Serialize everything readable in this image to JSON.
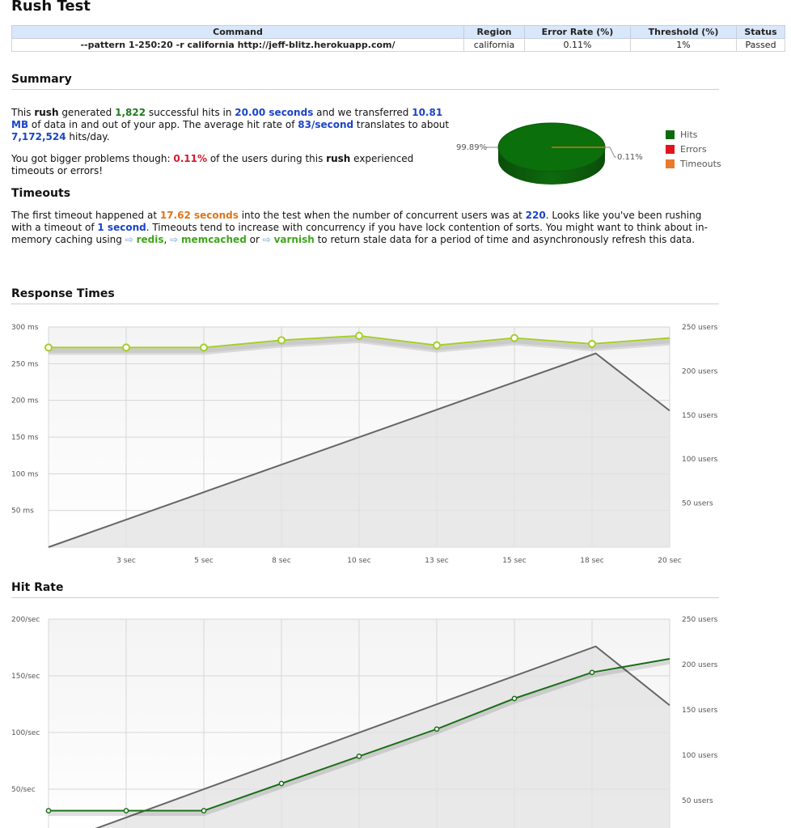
{
  "title": "Rush Test",
  "table": {
    "headers": [
      "Command",
      "Region",
      "Error Rate (%)",
      "Threshold (%)",
      "Status"
    ],
    "row": [
      "--pattern 1-250:20 -r california http://jeff-blitz.herokuapp.com/",
      "california",
      "0.11%",
      "1%",
      "Passed"
    ]
  },
  "summary": {
    "heading": "Summary",
    "p1": {
      "t1": "This ",
      "rush": "rush",
      "t2": " generated ",
      "hits": "1,822",
      "t3": " successful hits in ",
      "secs": "20.00 seconds",
      "t4": " and we transferred ",
      "mb": "10.81 MB",
      "t5": " of data in and out of your app. The average hit rate of ",
      "rate": "83/second",
      "t6": " translates to about ",
      "perday": "7,172,524",
      "t7": " hits/day."
    },
    "p2": {
      "t1": "You got bigger problems though: ",
      "pct": "0.11%",
      "t2": " of the users during this ",
      "rush": "rush",
      "t3": " experienced timeouts or errors!"
    }
  },
  "pie": {
    "hits_pct": 99.89,
    "errors_pct": 0.0,
    "timeouts_pct": 0.11,
    "label_hits": "99.89%",
    "label_timeouts": "0.11%",
    "legend": [
      {
        "label": "Hits",
        "color": "#0b6b0b"
      },
      {
        "label": "Errors",
        "color": "#e0141e"
      },
      {
        "label": "Timeouts",
        "color": "#e87a2e"
      }
    ]
  },
  "timeouts": {
    "heading": "Timeouts",
    "t1": "The first timeout happened at ",
    "at": "17.62 seconds",
    "t2": " into the test when the number of concurrent users was at ",
    "users": "220",
    "t3": ". Looks like you've been rushing with a timeout of ",
    "timeout": "1 second",
    "t4": ". Timeouts tend to increase with concurrency if you have lock contention of sorts. You might want to think about in-memory caching using ",
    "redis": "redis",
    "sep1": ", ",
    "memcached": "memcached",
    "sep2": " or ",
    "varnish": "varnish",
    "t5": " to return stale data for a period of time and asynchronously refresh this data.",
    "arrow": "⇨"
  },
  "colors": {
    "hits_line": "#1a6e17",
    "response_line": "#a4cf28",
    "users_line": "#666666"
  },
  "chart_data": [
    {
      "type": "line",
      "title": "Response Times",
      "x": [
        0,
        2.5,
        5,
        7.5,
        10,
        12.5,
        15,
        17.5,
        20
      ],
      "x_tick_labels": [
        "3 sec",
        "5 sec",
        "8 sec",
        "10 sec",
        "13 sec",
        "15 sec",
        "18 sec",
        "20 sec"
      ],
      "y_left_ticks": [
        "300 ms",
        "250 ms",
        "200 ms",
        "150 ms",
        "100 ms",
        "50 ms"
      ],
      "y_right_ticks": [
        "250 users",
        "200 users",
        "150 users",
        "100 users",
        "50 users"
      ],
      "ylim_left": [
        0,
        300
      ],
      "ylim_right": [
        0,
        250
      ],
      "series": [
        {
          "axis": "left",
          "values": [
            272,
            272,
            272,
            282,
            288,
            275,
            285,
            277,
            285
          ],
          "markers": [
            true,
            true,
            true,
            true,
            true,
            true,
            true,
            true,
            false
          ]
        },
        {
          "axis": "right",
          "x": [
            0,
            17.62,
            20
          ],
          "values": [
            0,
            220,
            155
          ]
        }
      ]
    },
    {
      "type": "line",
      "title": "Hit Rate",
      "x": [
        0,
        2.5,
        5,
        7.5,
        10,
        12.5,
        15,
        17.5,
        20
      ],
      "y_left_ticks": [
        "200/sec",
        "150/sec",
        "100/sec",
        "50/sec"
      ],
      "y_right_ticks": [
        "250 users",
        "200 users",
        "150 users",
        "100 users",
        "50 users"
      ],
      "ylim_left": [
        0,
        200
      ],
      "ylim_right": [
        0,
        250
      ],
      "series": [
        {
          "axis": "left",
          "values": [
            31,
            31,
            31,
            55,
            79,
            103,
            130,
            153,
            165
          ],
          "markers": [
            true,
            true,
            true,
            true,
            true,
            true,
            true,
            true,
            false
          ]
        },
        {
          "axis": "right",
          "x": [
            0,
            17.62,
            20
          ],
          "values": [
            0,
            220,
            155
          ]
        }
      ]
    }
  ],
  "response": {
    "heading": "Response Times"
  },
  "hitrate": {
    "heading": "Hit Rate"
  }
}
